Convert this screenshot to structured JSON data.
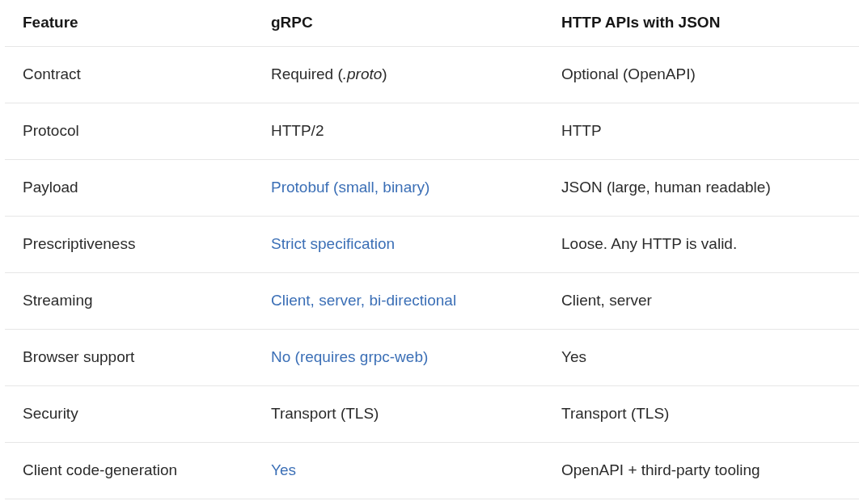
{
  "table": {
    "columns": [
      "Feature",
      "gRPC",
      "HTTP APIs with JSON"
    ],
    "rows": [
      {
        "cells": [
          {
            "text": "Contract",
            "highlighted": false
          },
          {
            "text": "Required (*.proto*)",
            "highlighted": false
          },
          {
            "text": "Optional (OpenAPI)",
            "highlighted": false
          }
        ]
      },
      {
        "cells": [
          {
            "text": "Protocol",
            "highlighted": false
          },
          {
            "text": "HTTP/2",
            "highlighted": false
          },
          {
            "text": "HTTP",
            "highlighted": false
          }
        ]
      },
      {
        "cells": [
          {
            "text": "Payload",
            "highlighted": false
          },
          {
            "text": "Protobuf (small, binary)",
            "highlighted": true
          },
          {
            "text": "JSON (large, human readable)",
            "highlighted": false
          }
        ]
      },
      {
        "cells": [
          {
            "text": "Prescriptiveness",
            "highlighted": false
          },
          {
            "text": "Strict specification",
            "highlighted": true
          },
          {
            "text": "Loose. Any HTTP is valid.",
            "highlighted": false
          }
        ]
      },
      {
        "cells": [
          {
            "text": "Streaming",
            "highlighted": false
          },
          {
            "text": "Client, server, bi-directional",
            "highlighted": true
          },
          {
            "text": "Client, server",
            "highlighted": false
          }
        ]
      },
      {
        "cells": [
          {
            "text": "Browser support",
            "highlighted": false
          },
          {
            "text": "No (requires grpc-web)",
            "highlighted": true
          },
          {
            "text": "Yes",
            "highlighted": false
          }
        ]
      },
      {
        "cells": [
          {
            "text": "Security",
            "highlighted": false
          },
          {
            "text": "Transport (TLS)",
            "highlighted": false
          },
          {
            "text": "Transport (TLS)",
            "highlighted": false
          }
        ]
      },
      {
        "cells": [
          {
            "text": "Client code-generation",
            "highlighted": false
          },
          {
            "text": "Yes",
            "highlighted": true
          },
          {
            "text": "OpenAPI + third-party tooling",
            "highlighted": false
          }
        ]
      }
    ]
  }
}
